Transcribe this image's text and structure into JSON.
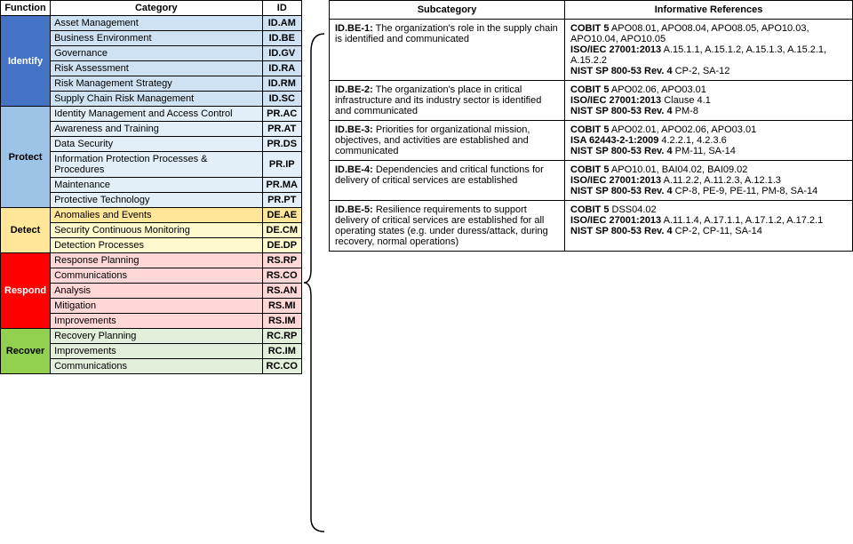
{
  "header": {
    "function_label": "Function",
    "category_label": "Category",
    "id_label": "ID",
    "subcategory_label": "Subcategory",
    "informative_references_label": "Informative References"
  },
  "functions": [
    {
      "name": "Identify",
      "class": "identify-bg",
      "rowClass": "row-identify",
      "categories": [
        {
          "name": "Asset Management",
          "id": "ID.AM"
        },
        {
          "name": "Business Environment",
          "id": "ID.BE"
        },
        {
          "name": "Governance",
          "id": "ID.GV"
        },
        {
          "name": "Risk Assessment",
          "id": "ID.RA"
        },
        {
          "name": "Risk Management Strategy",
          "id": "ID.RM"
        },
        {
          "name": "Supply Chain Risk Management",
          "id": "ID.SC"
        }
      ]
    },
    {
      "name": "Protect",
      "class": "protect-bg",
      "rowClass": "row-protect",
      "categories": [
        {
          "name": "Identity Management and Access Control",
          "id": "PR.AC"
        },
        {
          "name": "Awareness and Training",
          "id": "PR.AT"
        },
        {
          "name": "Data Security",
          "id": "PR.DS"
        },
        {
          "name": "Information Protection Processes & Procedures",
          "id": "PR.IP"
        },
        {
          "name": "Maintenance",
          "id": "PR.MA"
        },
        {
          "name": "Protective Technology",
          "id": "PR.PT"
        }
      ]
    },
    {
      "name": "Detect",
      "class": "detect-bg",
      "rowClass": "row-detect",
      "categories": [
        {
          "name": "Anomalies and Events",
          "id": "DE.AE",
          "special": "row-detect-ae"
        },
        {
          "name": "Security Continuous Monitoring",
          "id": "DE.CM"
        },
        {
          "name": "Detection Processes",
          "id": "DE.DP"
        }
      ]
    },
    {
      "name": "Respond",
      "class": "respond-bg",
      "rowClass": "row-respond",
      "categories": [
        {
          "name": "Response Planning",
          "id": "RS.RP"
        },
        {
          "name": "Communications",
          "id": "RS.CO"
        },
        {
          "name": "Analysis",
          "id": "RS.AN"
        },
        {
          "name": "Mitigation",
          "id": "RS.MI"
        },
        {
          "name": "Improvements",
          "id": "RS.IM"
        }
      ]
    },
    {
      "name": "Recover",
      "class": "recover-bg",
      "rowClass": "row-recover",
      "categories": [
        {
          "name": "Recovery Planning",
          "id": "RC.RP"
        },
        {
          "name": "Improvements",
          "id": "RC.IM"
        },
        {
          "name": "Communications",
          "id": "RC.CO"
        }
      ]
    }
  ],
  "subcategories": [
    {
      "id": "ID.BE-1:",
      "text": " The organization's role in the supply chain is identified and communicated",
      "references": [
        {
          "bold": "COBIT 5",
          "normal": " APO08.01, APO08.04, APO08.05, APO10.03, APO10.04, APO10.05"
        },
        {
          "bold": "ISO/IEC 27001:2013",
          "normal": " A.15.1.1, A.15.1.2, A.15.1.3, A.15.2.1, A.15.2.2"
        },
        {
          "bold": "NIST SP 800-53 Rev. 4",
          "normal": " CP-2, SA-12"
        }
      ]
    },
    {
      "id": "ID.BE-2:",
      "text": " The organization's place in critical infrastructure and its industry sector is identified and communicated",
      "references": [
        {
          "bold": "COBIT 5",
          "normal": " APO02.06, APO03.01"
        },
        {
          "bold": "ISO/IEC 27001:2013",
          "normal": " Clause 4.1"
        },
        {
          "bold": "NIST SP 800-53 Rev. 4",
          "normal": " PM-8"
        }
      ]
    },
    {
      "id": "ID.BE-3:",
      "text": " Priorities for organizational mission, objectives, and activities are established and communicated",
      "references": [
        {
          "bold": "COBIT 5",
          "normal": " APO02.01, APO02.06, APO03.01"
        },
        {
          "bold": "ISA 62443-2-1:2009",
          "normal": " 4.2.2.1, 4.2.3.6"
        },
        {
          "bold": "NIST SP 800-53 Rev. 4",
          "normal": " PM-11, SA-14"
        }
      ]
    },
    {
      "id": "ID.BE-4:",
      "text": " Dependencies and critical functions for delivery of critical services are established",
      "references": [
        {
          "bold": "COBIT 5",
          "normal": " APO10.01, BAI04.02, BAI09.02"
        },
        {
          "bold": "ISO/IEC 27001:2013",
          "normal": " A.11.2.2, A.11.2.3, A.12.1.3"
        },
        {
          "bold": "NIST SP 800-53 Rev. 4",
          "normal": " CP-8, PE-9, PE-11, PM-8, SA-14"
        }
      ]
    },
    {
      "id": "ID.BE-5:",
      "text": " Resilience requirements to support delivery of critical services are established for all operating states (e.g. under duress/attack, during recovery, normal operations)",
      "references": [
        {
          "bold": "COBIT 5",
          "normal": " DSS04.02"
        },
        {
          "bold": "ISO/IEC 27001:2013",
          "normal": " A.11.1.4, A.17.1.1, A.17.1.2, A.17.2.1"
        },
        {
          "bold": "NIST SP 800-53 Rev. 4",
          "normal": " CP-2, CP-11, SA-14"
        }
      ]
    }
  ]
}
